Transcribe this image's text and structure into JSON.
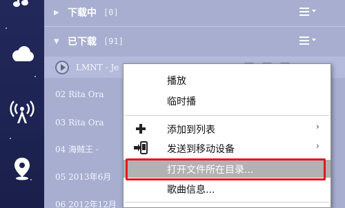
{
  "sidebar": {
    "items": [
      {
        "icon": "music-note-icon"
      },
      {
        "icon": "cloud-icon"
      },
      {
        "icon": "radio-tower-icon"
      },
      {
        "icon": "location-pin-icon"
      }
    ]
  },
  "groups": {
    "downloading": {
      "label": "下载中",
      "count": "[0]"
    },
    "downloaded": {
      "label": "已下载",
      "count": "[91]"
    }
  },
  "songs": [
    {
      "title": "LMNT - Je"
    },
    {
      "title": "02 Rita Ora"
    },
    {
      "title": "03 Rita Ora"
    },
    {
      "title": "04 海贼王 -"
    },
    {
      "title": "05 2013年6月"
    },
    {
      "title": "06 2012年12月"
    }
  ],
  "context_menu": {
    "items": [
      {
        "label": "播放"
      },
      {
        "label": "临时播"
      },
      {
        "label": "添加到列表"
      },
      {
        "label": "发送到移动设备"
      },
      {
        "label": "打开文件所在目录..."
      },
      {
        "label": "歌曲信息..."
      }
    ],
    "highlighted_color": "#b2b2b2",
    "annotation_box_color": "#e0191f"
  }
}
